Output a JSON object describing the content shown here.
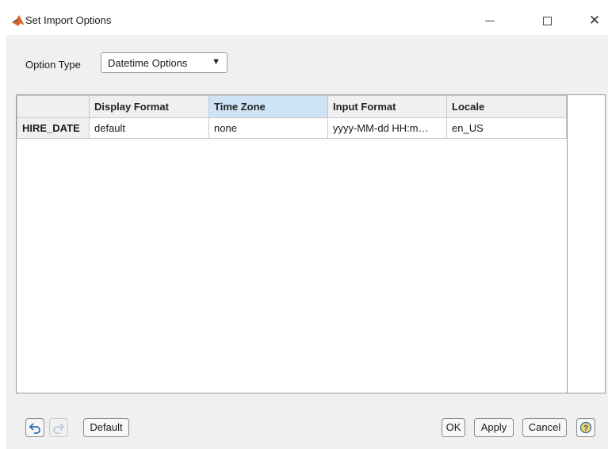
{
  "window": {
    "title": "Set Import Options",
    "accent": "#e3621e"
  },
  "option_type": {
    "label": "Option Type",
    "selected": "Datetime Options",
    "arrow": "▼"
  },
  "table": {
    "columns": [
      "",
      "Display Format",
      "Time Zone",
      "Input Format",
      "Locale"
    ],
    "selected_column": "Time Zone",
    "rows": [
      {
        "name": "HIRE_DATE",
        "cells": [
          "default",
          "none",
          "yyyy-MM-dd HH:m…",
          "en_US"
        ]
      }
    ]
  },
  "buttons": {
    "undo_icon": "undo-icon",
    "redo_icon": "redo-icon",
    "default": "Default",
    "ok": "OK",
    "apply": "Apply",
    "cancel": "Cancel",
    "help_icon": "help-icon"
  }
}
